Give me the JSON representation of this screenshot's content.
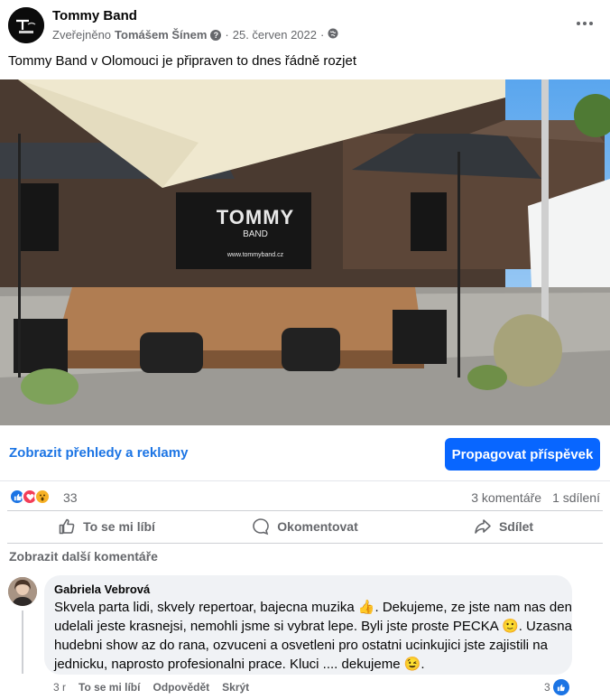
{
  "post": {
    "page_name": "Tommy Band",
    "published_by_prefix": "Zveřejněno",
    "published_by": "Tomášem Šínem",
    "help_icon": "question-icon",
    "date": "25. červen 2022",
    "separator": "·",
    "audience_icon": "globe-icon",
    "text": "Tommy Band v Olomouci je připraven to dnes řádně rozjet",
    "photo_sign_title": "TOMMY",
    "photo_sign_subtitle": "BAND",
    "photo_sign_url": "www.tommyband.cz"
  },
  "insights": {
    "link": "Zobrazit přehledy a reklamy",
    "promote_button": "Propagovat příspěvek"
  },
  "reactions": {
    "icons": [
      "like-reaction-icon",
      "love-reaction-icon",
      "wow-reaction-icon"
    ],
    "count": "33",
    "comments": "3 komentáře",
    "shares": "1 sdílení"
  },
  "actions": {
    "like": "To se mi líbí",
    "comment": "Okomentovat",
    "share": "Sdílet"
  },
  "comments": {
    "show_more": "Zobrazit další komentáře",
    "items": [
      {
        "author": "Gabriela Vebrová",
        "line1": "Skvela parta lidi, skvely repertoar, bajecna muzika 👍. Dekujeme, ze jste nam nas den",
        "line2": "udelali jeste krasnejsi, nemohli jsme si vybrat lepe. Byli jste proste PECKA 🙂. Uzasna",
        "line3": "hudebni show az do rana, ozvuceni a osvetleni pro ostatni ucinkujici jste zajistili na",
        "line4": "jednicku, naprosto profesionalni prace. Kluci .... dekujeme 😉.",
        "age": "3 r",
        "like_label": "To se mi líbí",
        "reply_label": "Odpovědět",
        "hide_label": "Skrýt",
        "like_count": "3"
      }
    ]
  },
  "colors": {
    "accent": "#0866ff",
    "link": "#1b74e4",
    "muted": "#65676b",
    "bubble": "#f0f2f5"
  }
}
